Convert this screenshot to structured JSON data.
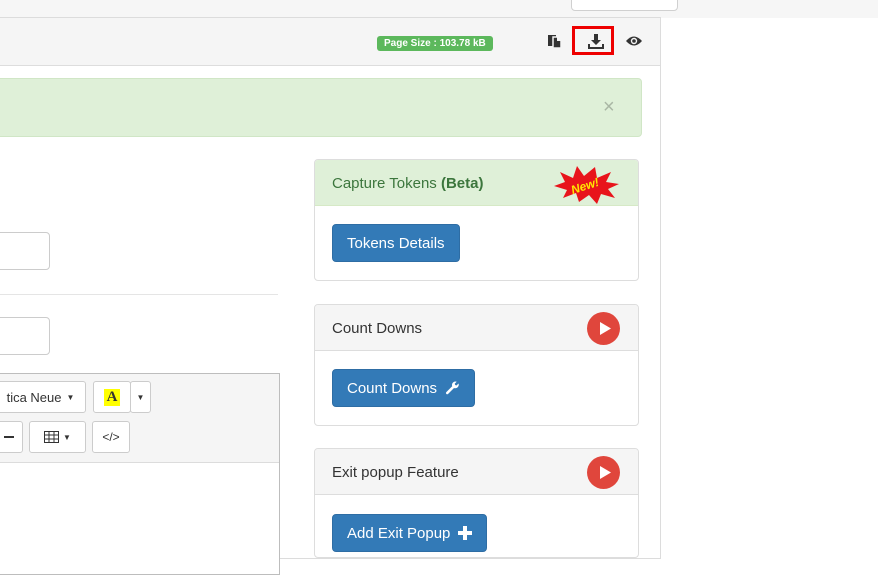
{
  "header": {
    "page_size_label": "Page Size : 103.78 kB",
    "icons": [
      "copy-icon",
      "download-icon",
      "eye-icon"
    ]
  },
  "alert": {
    "close_label": "×"
  },
  "editor": {
    "font_name": "tica Neue",
    "color_btn_label": "A",
    "code_btn_label": "</>"
  },
  "capture_tokens": {
    "title": "Capture Tokens",
    "title_suffix": "(Beta)",
    "badge": "New!",
    "button_label": "Tokens Details"
  },
  "count_downs": {
    "title": "Count Downs",
    "button_label": "Count Downs"
  },
  "exit_popup": {
    "title": "Exit popup Feature",
    "button_label": "Add Exit Popup"
  },
  "colors": {
    "badge_green": "#5cb85c",
    "highlight_red": "#ee0000",
    "primary_blue": "#337ab7",
    "play_red": "#e0463c"
  }
}
